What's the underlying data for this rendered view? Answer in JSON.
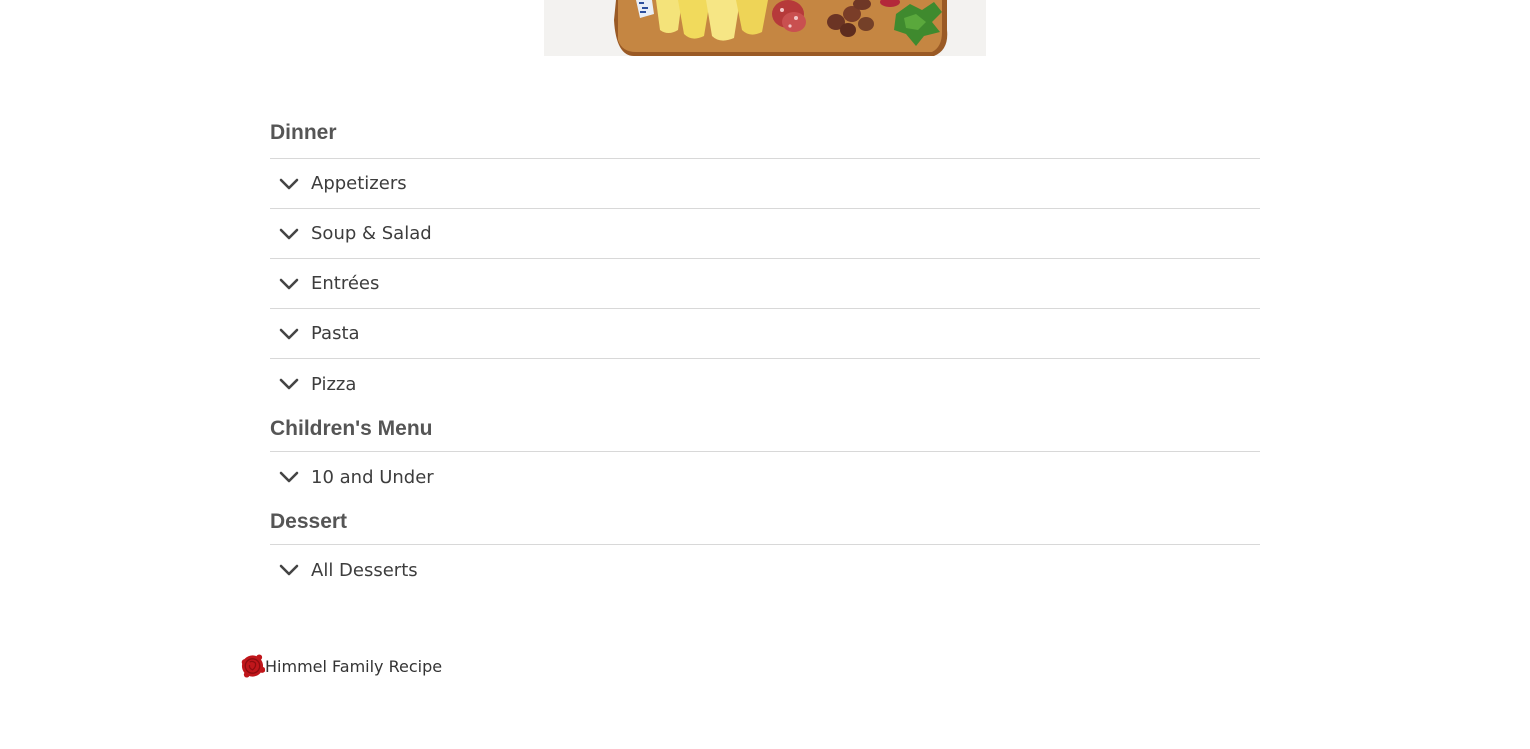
{
  "hero": {
    "image_name": "charcuterie-board-image"
  },
  "menu": {
    "sections": [
      {
        "title": "Dinner",
        "items": [
          {
            "label": "Appetizers",
            "icon": "chevron-down-icon"
          },
          {
            "label": "Soup & Salad",
            "icon": "chevron-down-icon"
          },
          {
            "label": "Entrées",
            "icon": "chevron-down-icon"
          },
          {
            "label": "Pasta",
            "icon": "chevron-down-icon"
          },
          {
            "label": "Pizza",
            "icon": "chevron-down-icon"
          }
        ]
      },
      {
        "title": "Children's Menu",
        "items": [
          {
            "label": "10 and Under",
            "icon": "chevron-down-icon"
          }
        ]
      },
      {
        "title": "Dessert",
        "items": [
          {
            "label": "All Desserts",
            "icon": "chevron-down-icon"
          }
        ]
      }
    ]
  },
  "footer": {
    "icon": "family-recipe-seal-icon",
    "text": "Himmel Family Recipe",
    "seal_color": "#c0161b"
  },
  "colors": {
    "heading": "#555555",
    "text": "#3d3d3d",
    "divider": "#d8d8d8"
  }
}
